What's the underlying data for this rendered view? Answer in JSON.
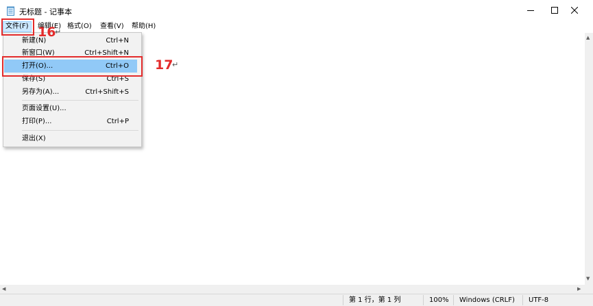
{
  "window": {
    "title": "无标题 - 记事本",
    "minimize_glyph": "—",
    "maximize_glyph": "☐",
    "close_glyph": "✕"
  },
  "menubar": {
    "file": "文件(F)",
    "edit": "编辑(E)",
    "format": "格式(O)",
    "view": "查看(V)",
    "help": "帮助(H)"
  },
  "file_menu": {
    "items": [
      {
        "label": "新建(N)",
        "shortcut": "Ctrl+N"
      },
      {
        "label": "新窗口(W)",
        "shortcut": "Ctrl+Shift+N"
      },
      {
        "label": "打开(O)...",
        "shortcut": "Ctrl+O"
      },
      {
        "label": "保存(S)",
        "shortcut": "Ctrl+S"
      },
      {
        "label": "另存为(A)...",
        "shortcut": "Ctrl+Shift+S"
      },
      {
        "label": "页面设置(U)...",
        "shortcut": ""
      },
      {
        "label": "打印(P)...",
        "shortcut": "Ctrl+P"
      },
      {
        "label": "退出(X)",
        "shortcut": ""
      }
    ],
    "highlighted_item": "打开(O)..."
  },
  "annotations": {
    "step_16": "16",
    "step_17": "17",
    "return_mark": "↵",
    "color": "#e32b2b"
  },
  "statusbar": {
    "position": "第 1 行，第 1 列",
    "zoom": "100%",
    "line_ending": "Windows (CRLF)",
    "encoding": "UTF-8"
  },
  "colors": {
    "menu_highlight": "#91c9f7",
    "menu_active": "#cce8ff",
    "annotation_red": "#e32b2b"
  }
}
